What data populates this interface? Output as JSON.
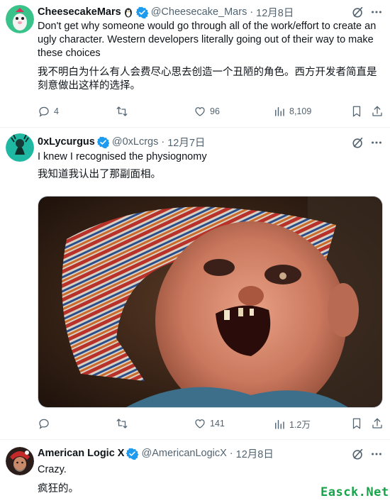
{
  "colors": {
    "verified": "#1d9bf0",
    "secondary_text": "#536471",
    "watermark": "#17a34a"
  },
  "tweets": [
    {
      "name": "CheesecakeMars",
      "handle": "@Cheesecake_Mars",
      "sep": "·",
      "date": "12月8日",
      "text_en": "Don't get why someone would go through all of the work/effort to create an ugly character. Western developers literally going out of their way to make these choices",
      "text_zh": "我不明白为什么有人会费尽心思去创造一个丑陋的角色。西方开发者简直是刻意做出这样的选择。",
      "replies": "4",
      "retweets": "",
      "likes": "96",
      "views": "8,109",
      "icons": [
        "penguin-icon",
        "verified-badge-icon",
        "grok-icon",
        "more-icon"
      ]
    },
    {
      "name": "0xLycurgus",
      "handle": "@0xLcrgs",
      "sep": "·",
      "date": "12月7日",
      "text_en": "I knew I recognised the physiognomy",
      "text_zh": "我知道我认出了那副面相。",
      "replies": "",
      "retweets": "",
      "likes": "141",
      "views": "1.2万",
      "icons": [
        "verified-badge-icon",
        "grok-icon",
        "more-icon"
      ]
    },
    {
      "name": "American Logic X",
      "handle": "@AmericanLogicX",
      "sep": "·",
      "date": "12月8日",
      "text_en": "Crazy.",
      "text_zh": "疯狂的。",
      "icons": [
        "verified-badge-icon",
        "grok-icon",
        "more-icon"
      ]
    }
  ],
  "watermark": "Easck.Net"
}
